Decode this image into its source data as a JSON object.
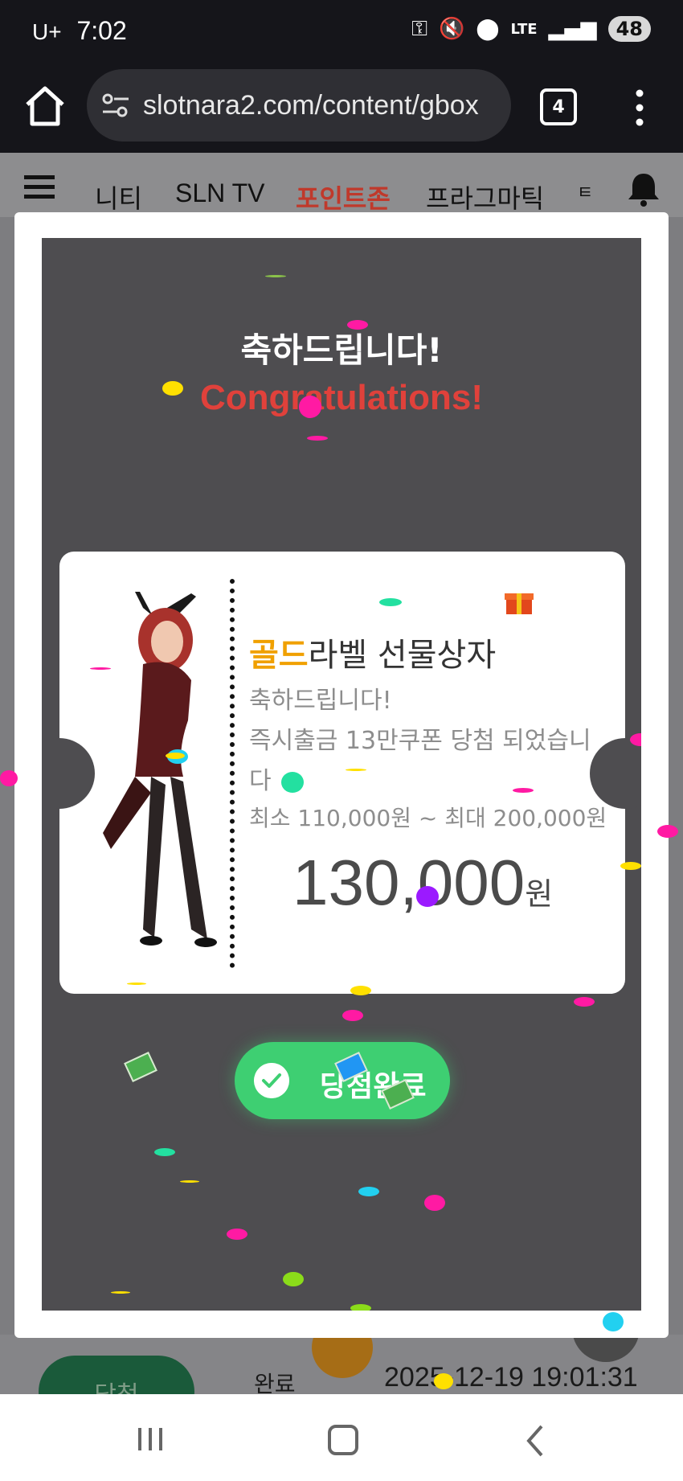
{
  "status_bar": {
    "carrier": "U+",
    "time": "7:02",
    "network": "LTE",
    "battery": "48"
  },
  "browser": {
    "url": "slotnara2.com/content/gbox",
    "tab_count": "4"
  },
  "site_nav": {
    "items": [
      "니티",
      "SLN TV",
      "포인트존",
      "프라그마틱",
      "ㅌ"
    ],
    "active_color": "#c0392b"
  },
  "modal": {
    "title_ko": "축하드립니다!",
    "title_en": "Congratulations!",
    "coupon": {
      "title_gold": "골드",
      "title_rest": "라벨 선물상자",
      "line1": "축하드립니다!",
      "line2": "즉시출금 13만쿠폰 당첨 되었습니",
      "line3": "다",
      "range": "최소 110,000원 ~ 최대 200,000원",
      "amount": "130,000",
      "unit": "원"
    },
    "done_button": "당첨완료"
  },
  "background_row": {
    "win_label": "당첨",
    "status": "완료",
    "date": "2025-12-19 19:01:31"
  },
  "colors": {
    "overlay": "#4e4d50",
    "title_en": "#e0413b",
    "gold": "#f0a000",
    "button_green": "#3ecf72"
  }
}
